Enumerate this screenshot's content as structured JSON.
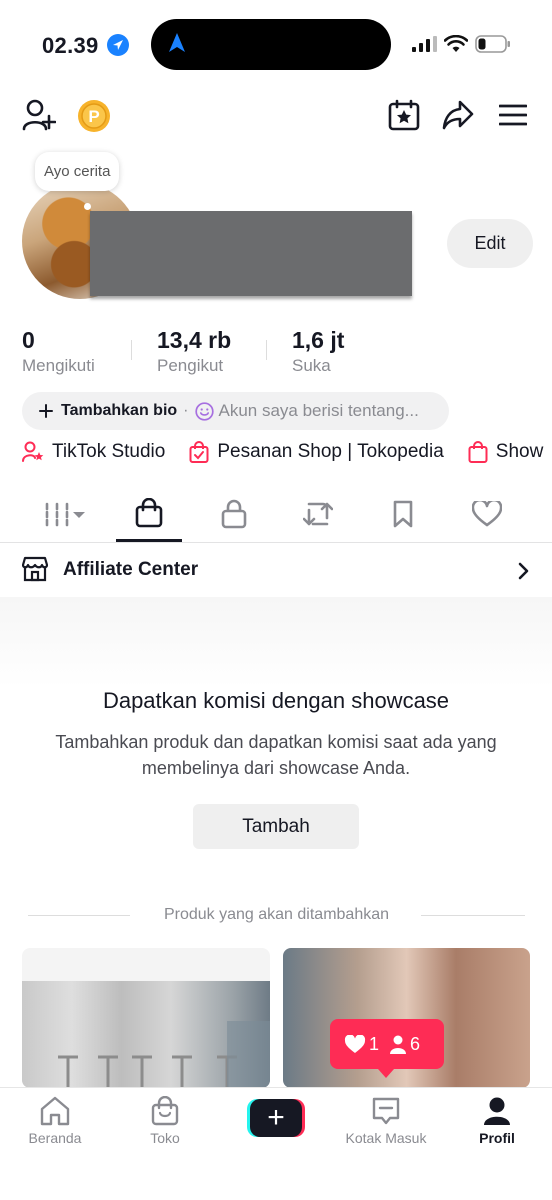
{
  "status_bar": {
    "time": "02.39"
  },
  "profile": {
    "story_bubble": "Ayo cerita",
    "edit_label": "Edit",
    "stats": [
      {
        "value": "0",
        "label": "Mengikuti"
      },
      {
        "value": "13,4 rb",
        "label": "Pengikut"
      },
      {
        "value": "1,6 jt",
        "label": "Suka"
      }
    ],
    "bio": {
      "add_label": "Tambahkan bio",
      "separator": "·",
      "placeholder": "Akun saya berisi tentang..."
    },
    "links": [
      "TikTok Studio",
      "Pesanan Shop | Tokopedia",
      "Show"
    ]
  },
  "tabs": [
    "videos-grid",
    "shop",
    "private",
    "reposts",
    "favorites",
    "liked"
  ],
  "affiliate": {
    "label": "Affiliate Center"
  },
  "showcase": {
    "title": "Dapatkan komisi dengan showcase",
    "description": "Tambahkan produk dan dapatkan komisi saat ada yang membelinya dari showcase Anda.",
    "button": "Tambah",
    "divider": "Produk yang akan ditambahkan"
  },
  "notification_pill": {
    "likes": "1",
    "followers": "6"
  },
  "bottom_nav": [
    {
      "label": "Beranda"
    },
    {
      "label": "Toko"
    },
    {
      "label": ""
    },
    {
      "label": "Kotak Masuk"
    },
    {
      "label": "Profil"
    }
  ],
  "colors": {
    "accent": "#fe2c55",
    "cyan": "#25f4ee",
    "text": "#161823",
    "muted": "#8a8b91",
    "coin": "#f7b32b"
  }
}
